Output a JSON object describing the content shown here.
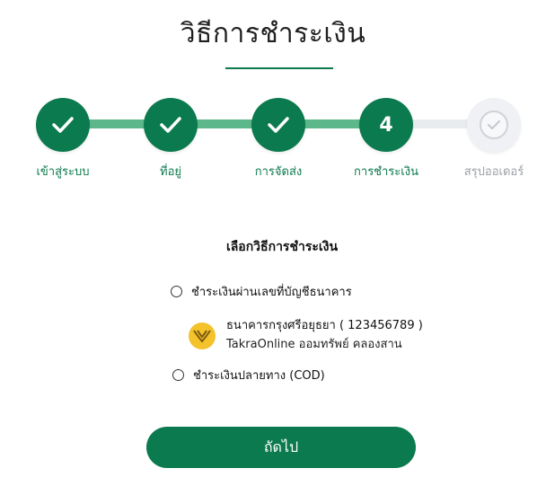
{
  "page": {
    "title": "วิธีการชำระเงิน"
  },
  "stepper": {
    "steps": [
      {
        "label": "เข้าสู่ระบบ",
        "state": "completed"
      },
      {
        "label": "ที่อยู่",
        "state": "completed"
      },
      {
        "label": "การจัดส่ง",
        "state": "completed"
      },
      {
        "label": "การชำระเงิน",
        "state": "current",
        "number": "4"
      },
      {
        "label": "สรุปออเดอร์",
        "state": "upcoming"
      }
    ],
    "colors": {
      "active": "#0b7a4e",
      "track": "#5cb88a",
      "inactive": "#eff1f4"
    }
  },
  "payment": {
    "section_title": "เลือกวิธีการชำระเงิน",
    "options": [
      {
        "label": "ชำระเงินผ่านเลขที่บัญชีธนาคาร",
        "selected": false
      },
      {
        "label": "ชำระเงินปลายทาง (COD)",
        "selected": false
      }
    ],
    "bank": {
      "name": "ธนาคารกรุงศรีอยุธยา ( 123456789 )",
      "account_name": "TakraOnline ออมทรัพย์ คลองสาน",
      "logo_color": "#f4c22b"
    }
  },
  "actions": {
    "next_label": "ถัดไป"
  }
}
